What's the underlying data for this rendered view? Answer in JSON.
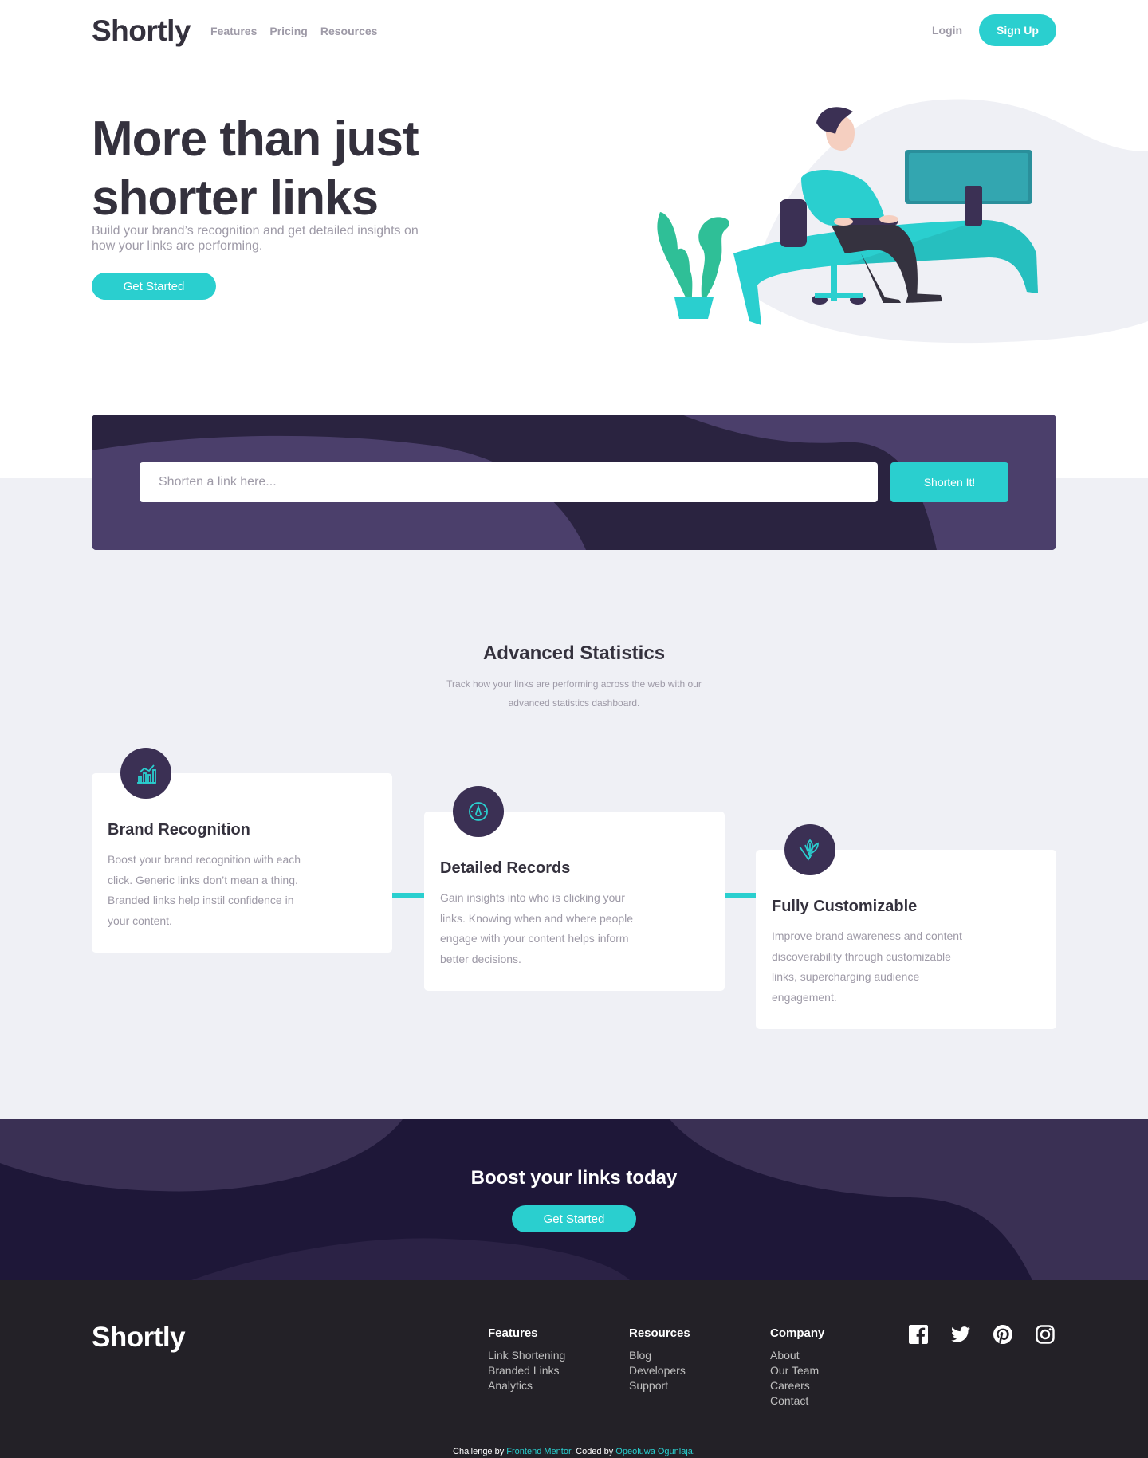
{
  "colors": {
    "primary": "#2acfcf",
    "dark_violet": "#3b3054",
    "very_dark_blue": "#34313d",
    "gray": "#9e9aa7",
    "light_gray_bg": "#eff0f5",
    "footer_bg": "#232127"
  },
  "nav": {
    "logo": "Shortly",
    "links": [
      "Features",
      "Pricing",
      "Resources"
    ],
    "login": "Login",
    "signup": "Sign Up"
  },
  "hero": {
    "title": "More than just shorter links",
    "subtitle": "Build your brand’s recognition and get detailed insights on how your links are performing.",
    "cta": "Get Started"
  },
  "shorten": {
    "placeholder": "Shorten a link here...",
    "button": "Shorten It!"
  },
  "stats": {
    "title": "Advanced Statistics",
    "subtitle": "Track how your links are performing across the web with our advanced statistics dashboard.",
    "cards": [
      {
        "icon": "brand-recognition-icon",
        "title": "Brand Recognition",
        "text": "Boost your brand recognition with each click. Generic links don’t mean a thing. Branded links help instil confidence in your content."
      },
      {
        "icon": "detailed-records-icon",
        "title": "Detailed Records",
        "text": "Gain insights into who is clicking your links. Knowing when and where people engage with your content helps inform better decisions."
      },
      {
        "icon": "fully-customizable-icon",
        "title": "Fully Customizable",
        "text": "Improve brand awareness and content discoverability through customizable links, supercharging audience engagement."
      }
    ]
  },
  "boost": {
    "title": "Boost your links today",
    "cta": "Get Started"
  },
  "footer": {
    "logo": "Shortly",
    "columns": [
      {
        "title": "Features",
        "items": [
          "Link Shortening",
          "Branded Links",
          "Analytics"
        ]
      },
      {
        "title": "Resources",
        "items": [
          "Blog",
          "Developers",
          "Support"
        ]
      },
      {
        "title": "Company",
        "items": [
          "About",
          "Our Team",
          "Careers",
          "Contact"
        ]
      }
    ],
    "socials": [
      "facebook-icon",
      "twitter-icon",
      "pinterest-icon",
      "instagram-icon"
    ],
    "attribution": {
      "prefix": "Challenge by ",
      "link1": "Frontend Mentor",
      "middle": ". Coded by ",
      "link2": "Opeoluwa Ogunlaja",
      "suffix": "."
    }
  }
}
